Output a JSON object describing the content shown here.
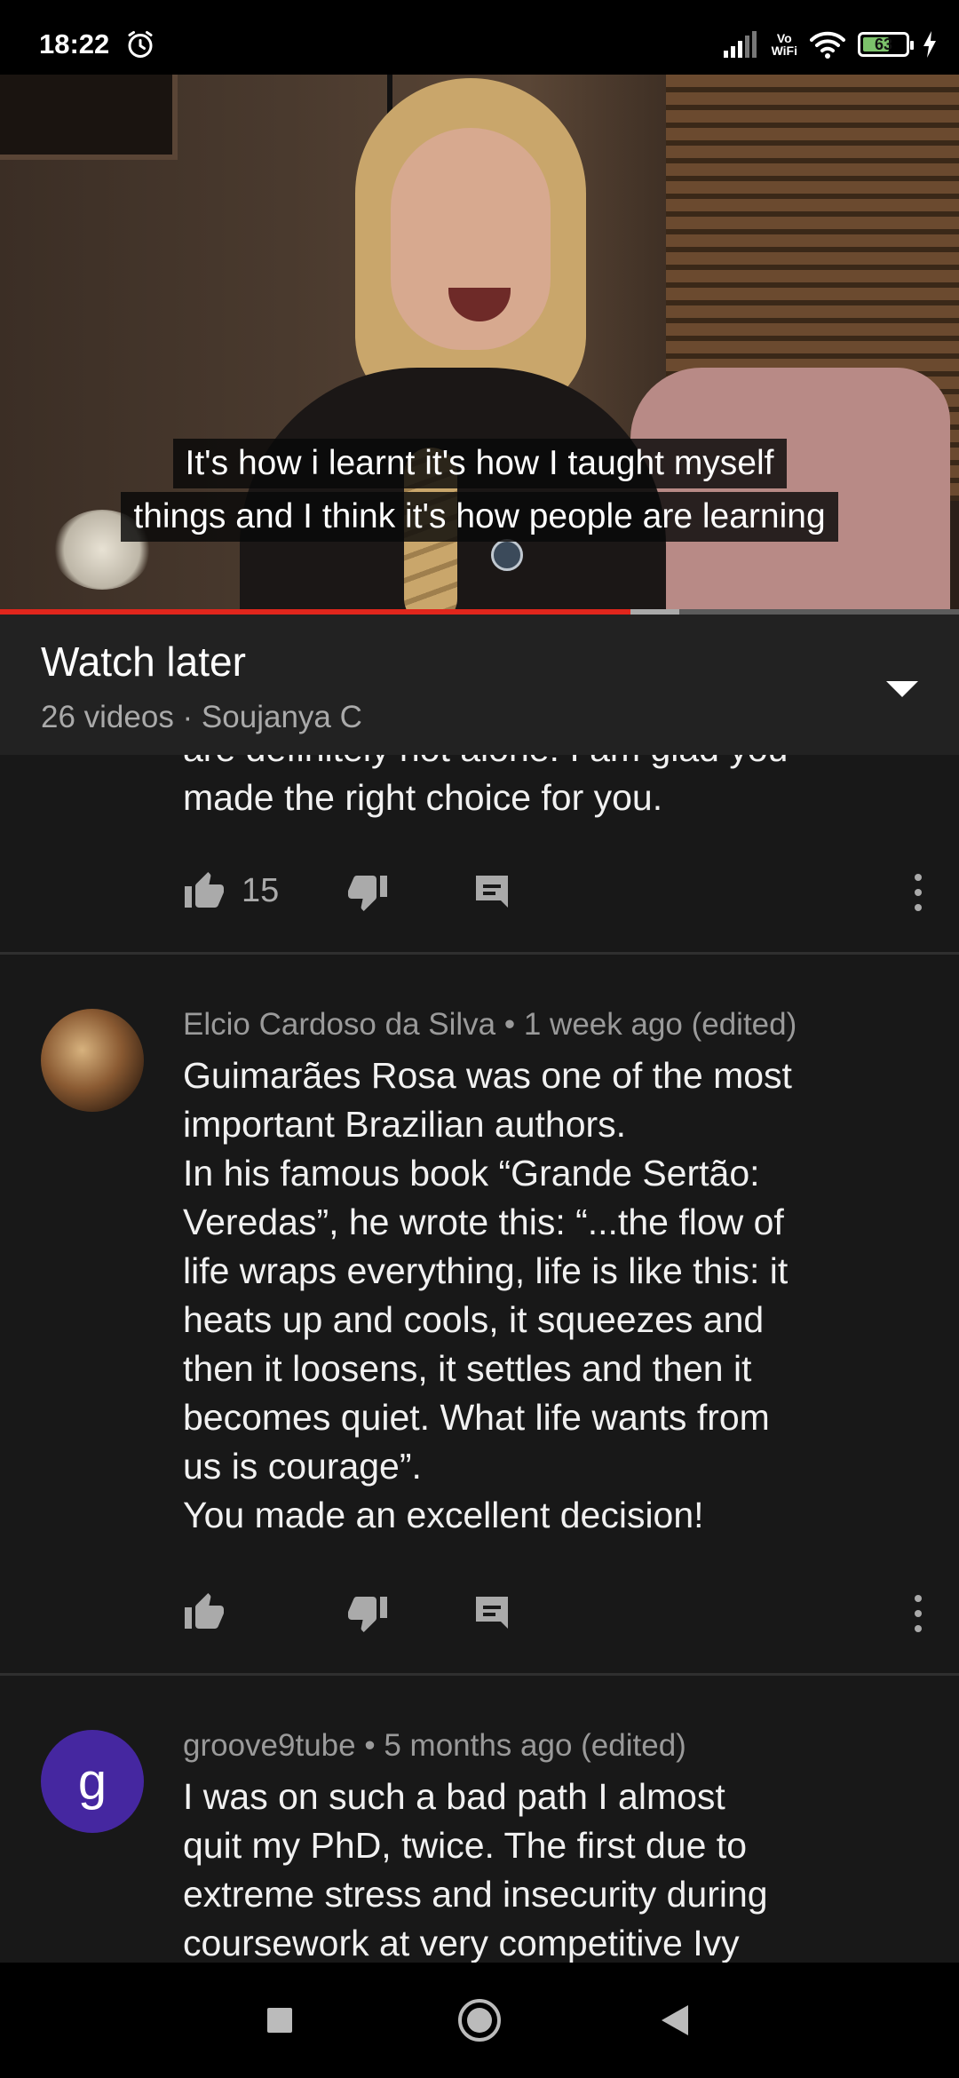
{
  "status_bar": {
    "time": "18:22",
    "volte_top": "Vo",
    "volte_bottom": "WiFi",
    "battery_level": "63",
    "icons": [
      "alarm-icon",
      "signal-icon",
      "vowifi-icon",
      "wifi-icon",
      "battery-icon",
      "charging-icon"
    ]
  },
  "video": {
    "caption_lines": [
      "It's how i learnt it's how I taught myself",
      "things and I think it's how people are learning"
    ],
    "progress_played_fraction": 0.657,
    "progress_buffered_fraction": 0.708
  },
  "playlist": {
    "title": "Watch later",
    "subtitle": "26 videos · Soujanya C",
    "toggle_icon": "chevron-down-icon"
  },
  "comments": [
    {
      "partial": true,
      "text_lines": [
        "are definitely not alone! I am glad you",
        "made the right choice for you."
      ],
      "likes": "15"
    },
    {
      "author": "Elcio Cardoso da Silva",
      "separator": "•",
      "time": "1 week ago (edited)",
      "text_lines": [
        "Guimarães Rosa was one of the most",
        "important Brazilian authors.",
        "In his famous book “Grande Sertão:",
        "Veredas”, he wrote this: “...the flow of",
        "life wraps everything, life is like this: it",
        "heats up and cools, it squeezes and",
        "then it loosens, it settles and then it",
        "becomes quiet. What life wants from",
        "us is courage”.",
        "You made an excellent decision!"
      ],
      "likes": ""
    },
    {
      "author": "groove9tube",
      "separator": "•",
      "time": "5 months ago (edited)",
      "avatar_letter": "g",
      "avatar_color": "#4527a0",
      "text_lines": [
        "I was on such a bad path I almost",
        "quit my PhD, twice. The first due to",
        "extreme stress and insecurity during",
        "coursework at very competitive Ivy"
      ]
    }
  ],
  "colors": {
    "accent_red": "#e1261c",
    "background": "#181818",
    "header_bg": "#222222",
    "secondary_text": "#aaaaaa"
  },
  "nav": {
    "recents_icon": "square-recents-icon",
    "home_icon": "circle-home-icon",
    "back_icon": "triangle-back-icon"
  }
}
